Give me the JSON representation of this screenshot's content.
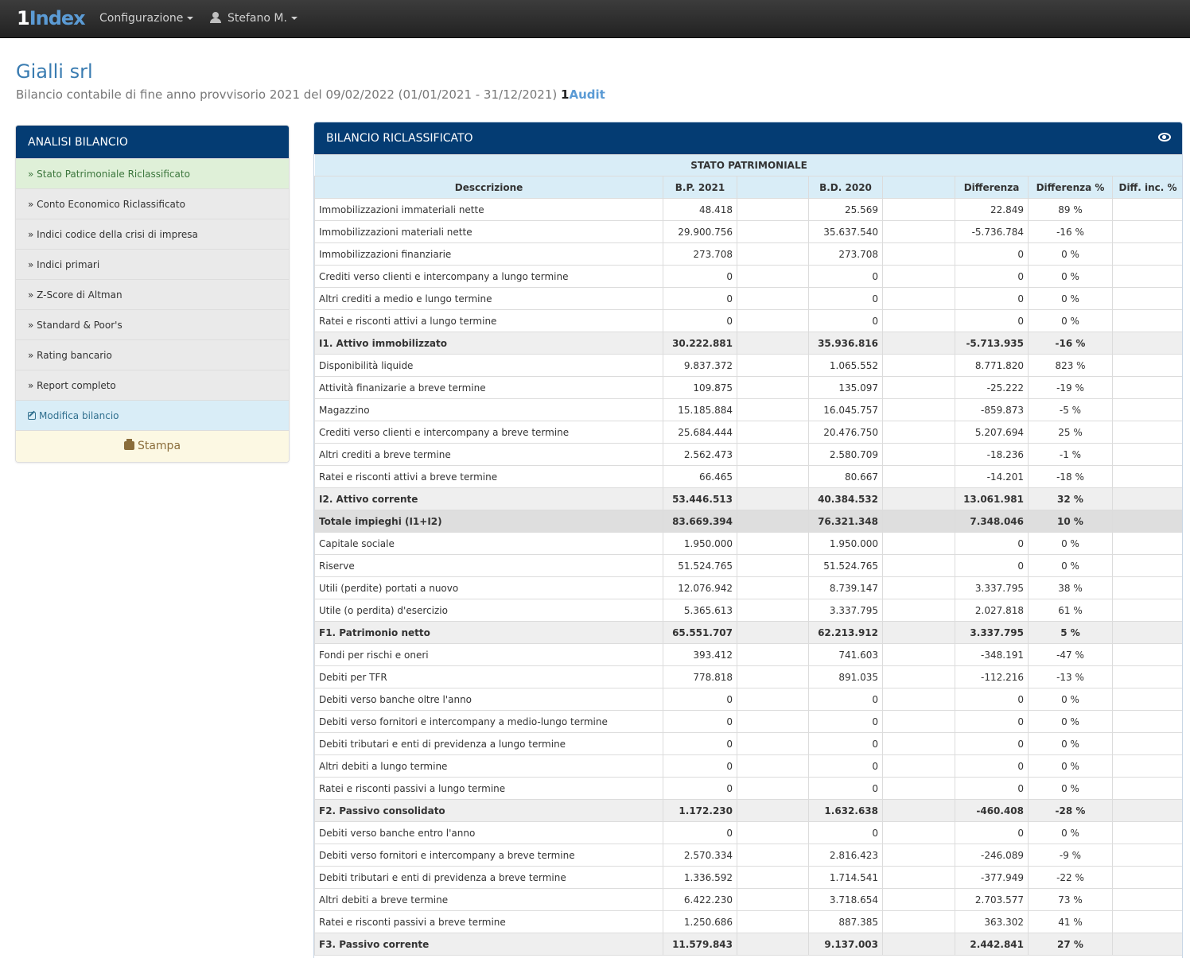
{
  "navbar": {
    "brand_prefix": "1",
    "brand_name": "Index",
    "menu_config": "Configurazione",
    "menu_user": "Stefano M."
  },
  "header": {
    "company": "Gialli srl",
    "subtitle": "Bilancio contabile di fine anno provvisorio 2021 del 09/02/2022 (01/01/2021 - 31/12/2021)",
    "audit_prefix": "1",
    "audit_name": "Audit"
  },
  "sidebar": {
    "title": "ANALISI BILANCIO",
    "items": [
      {
        "label": "» Stato Patrimoniale Riclassificato"
      },
      {
        "label": "» Conto Economico Riclassificato"
      },
      {
        "label": "» Indici codice della crisi di impresa"
      },
      {
        "label": "» Indici primari"
      },
      {
        "label": "» Z-Score di Altman"
      },
      {
        "label": "» Standard & Poor's"
      },
      {
        "label": "» Rating bancario"
      },
      {
        "label": "» Report completo"
      }
    ],
    "edit_label": "Modifica bilancio",
    "print_label": "Stampa"
  },
  "panel": {
    "title": "BILANCIO RICLASSIFICATO",
    "section": "STATO PATRIMONIALE",
    "columns": {
      "desc": "Desccrizione",
      "bp": "B.P. 2021",
      "bd": "B.D. 2020",
      "diff": "Differenza",
      "pct": "Differenza %",
      "inc": "Diff. inc. %"
    },
    "rows": [
      {
        "desc": "Immobilizzazioni immateriali nette",
        "bp": "48.418",
        "bd": "25.569",
        "diff": "22.849",
        "pct": "89 %",
        "inc": "",
        "type": "normal"
      },
      {
        "desc": "Immobilizzazioni materiali nette",
        "bp": "29.900.756",
        "bd": "35.637.540",
        "diff": "-5.736.784",
        "pct": "-16 %",
        "inc": "",
        "type": "normal"
      },
      {
        "desc": "Immobilizzazioni finanziarie",
        "bp": "273.708",
        "bd": "273.708",
        "diff": "0",
        "pct": "0 %",
        "inc": "",
        "type": "normal"
      },
      {
        "desc": "Crediti verso clienti e intercompany a lungo termine",
        "bp": "0",
        "bd": "0",
        "diff": "0",
        "pct": "0 %",
        "inc": "",
        "type": "normal"
      },
      {
        "desc": "Altri crediti a medio e lungo termine",
        "bp": "0",
        "bd": "0",
        "diff": "0",
        "pct": "0 %",
        "inc": "",
        "type": "normal"
      },
      {
        "desc": "Ratei e risconti attivi a lungo termine",
        "bp": "0",
        "bd": "0",
        "diff": "0",
        "pct": "0 %",
        "inc": "",
        "type": "normal"
      },
      {
        "desc": "I1. Attivo immobilizzato",
        "bp": "30.222.881",
        "bd": "35.936.816",
        "diff": "-5.713.935",
        "pct": "-16 %",
        "inc": "",
        "type": "sub"
      },
      {
        "desc": "Disponibilità liquide",
        "bp": "9.837.372",
        "bd": "1.065.552",
        "diff": "8.771.820",
        "pct": "823 %",
        "inc": "",
        "type": "normal"
      },
      {
        "desc": "Attività finanizarie a breve termine",
        "bp": "109.875",
        "bd": "135.097",
        "diff": "-25.222",
        "pct": "-19 %",
        "inc": "",
        "type": "normal"
      },
      {
        "desc": "Magazzino",
        "bp": "15.185.884",
        "bd": "16.045.757",
        "diff": "-859.873",
        "pct": "-5 %",
        "inc": "",
        "type": "normal"
      },
      {
        "desc": "Crediti verso clienti e intercompany a breve termine",
        "bp": "25.684.444",
        "bd": "20.476.750",
        "diff": "5.207.694",
        "pct": "25 %",
        "inc": "",
        "type": "normal"
      },
      {
        "desc": "Altri crediti a breve termine",
        "bp": "2.562.473",
        "bd": "2.580.709",
        "diff": "-18.236",
        "pct": "-1 %",
        "inc": "",
        "type": "normal"
      },
      {
        "desc": "Ratei e risconti attivi a breve termine",
        "bp": "66.465",
        "bd": "80.667",
        "diff": "-14.201",
        "pct": "-18 %",
        "inc": "",
        "type": "normal"
      },
      {
        "desc": "I2. Attivo corrente",
        "bp": "53.446.513",
        "bd": "40.384.532",
        "diff": "13.061.981",
        "pct": "32 %",
        "inc": "",
        "type": "sub"
      },
      {
        "desc": "Totale impieghi (I1+I2)",
        "bp": "83.669.394",
        "bd": "76.321.348",
        "diff": "7.348.046",
        "pct": "10 %",
        "inc": "",
        "type": "tot"
      },
      {
        "desc": "Capitale sociale",
        "bp": "1.950.000",
        "bd": "1.950.000",
        "diff": "0",
        "pct": "0 %",
        "inc": "",
        "type": "normal"
      },
      {
        "desc": "Riserve",
        "bp": "51.524.765",
        "bd": "51.524.765",
        "diff": "0",
        "pct": "0 %",
        "inc": "",
        "type": "normal"
      },
      {
        "desc": "Utili (perdite) portati a nuovo",
        "bp": "12.076.942",
        "bd": "8.739.147",
        "diff": "3.337.795",
        "pct": "38 %",
        "inc": "",
        "type": "normal"
      },
      {
        "desc": "Utile (o perdita) d'esercizio",
        "bp": "5.365.613",
        "bd": "3.337.795",
        "diff": "2.027.818",
        "pct": "61 %",
        "inc": "",
        "type": "normal"
      },
      {
        "desc": "F1. Patrimonio netto",
        "bp": "65.551.707",
        "bd": "62.213.912",
        "diff": "3.337.795",
        "pct": "5 %",
        "inc": "",
        "type": "sub"
      },
      {
        "desc": "Fondi per rischi e oneri",
        "bp": "393.412",
        "bd": "741.603",
        "diff": "-348.191",
        "pct": "-47 %",
        "inc": "",
        "type": "normal"
      },
      {
        "desc": "Debiti per TFR",
        "bp": "778.818",
        "bd": "891.035",
        "diff": "-112.216",
        "pct": "-13 %",
        "inc": "",
        "type": "normal"
      },
      {
        "desc": "Debiti verso banche oltre l'anno",
        "bp": "0",
        "bd": "0",
        "diff": "0",
        "pct": "0 %",
        "inc": "",
        "type": "normal"
      },
      {
        "desc": "Debiti verso fornitori e intercompany a medio-lungo termine",
        "bp": "0",
        "bd": "0",
        "diff": "0",
        "pct": "0 %",
        "inc": "",
        "type": "normal"
      },
      {
        "desc": "Debiti tributari e enti di previdenza a lungo termine",
        "bp": "0",
        "bd": "0",
        "diff": "0",
        "pct": "0 %",
        "inc": "",
        "type": "normal"
      },
      {
        "desc": "Altri debiti a lungo termine",
        "bp": "0",
        "bd": "0",
        "diff": "0",
        "pct": "0 %",
        "inc": "",
        "type": "normal"
      },
      {
        "desc": "Ratei e risconti passivi a lungo termine",
        "bp": "0",
        "bd": "0",
        "diff": "0",
        "pct": "0 %",
        "inc": "",
        "type": "normal"
      },
      {
        "desc": "F2. Passivo consolidato",
        "bp": "1.172.230",
        "bd": "1.632.638",
        "diff": "-460.408",
        "pct": "-28 %",
        "inc": "",
        "type": "sub"
      },
      {
        "desc": "Debiti verso banche entro l'anno",
        "bp": "0",
        "bd": "0",
        "diff": "0",
        "pct": "0 %",
        "inc": "",
        "type": "normal"
      },
      {
        "desc": "Debiti verso fornitori e intercompany a breve termine",
        "bp": "2.570.334",
        "bd": "2.816.423",
        "diff": "-246.089",
        "pct": "-9 %",
        "inc": "",
        "type": "normal"
      },
      {
        "desc": "Debiti tributari e enti di previdenza a breve termine",
        "bp": "1.336.592",
        "bd": "1.714.541",
        "diff": "-377.949",
        "pct": "-22 %",
        "inc": "",
        "type": "normal"
      },
      {
        "desc": "Altri debiti a breve termine",
        "bp": "6.422.230",
        "bd": "3.718.654",
        "diff": "2.703.577",
        "pct": "73 %",
        "inc": "",
        "type": "normal"
      },
      {
        "desc": "Ratei e risconti passivi a breve termine",
        "bp": "1.250.686",
        "bd": "887.385",
        "diff": "363.302",
        "pct": "41 %",
        "inc": "",
        "type": "normal"
      },
      {
        "desc": "F3. Passivo corrente",
        "bp": "11.579.843",
        "bd": "9.137.003",
        "diff": "2.442.841",
        "pct": "27 %",
        "inc": "",
        "type": "sub"
      }
    ]
  },
  "colors": {
    "navbar": "#2b2b2b",
    "panel_header": "#043c73",
    "title_blue": "#3a7cb1",
    "active_bg": "#dff0d8",
    "info_bg": "#d9edf7",
    "warning_bg": "#fcf8e3"
  }
}
